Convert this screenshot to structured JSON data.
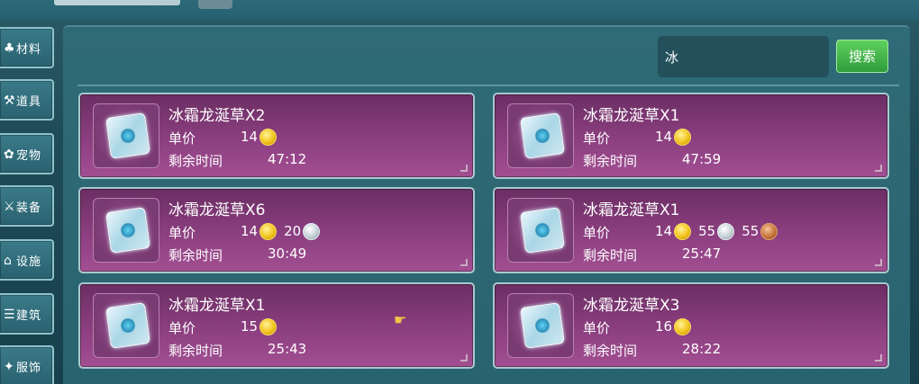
{
  "sidebar": {
    "items": [
      {
        "label": "材料",
        "icon": "leaf-icon"
      },
      {
        "label": "道具",
        "icon": "pickaxe-icon"
      },
      {
        "label": "宠物",
        "icon": "pet-icon"
      },
      {
        "label": "装备",
        "icon": "sword-icon"
      },
      {
        "label": "设施",
        "icon": "facility-icon"
      },
      {
        "label": "建筑",
        "icon": "building-icon"
      },
      {
        "label": "服饰",
        "icon": "clothes-icon"
      }
    ]
  },
  "search": {
    "value": "冰",
    "button_label": "搜索"
  },
  "labels": {
    "price": "单价",
    "time": "剩余时间"
  },
  "listings": [
    {
      "name": "冰霜龙涎草X2",
      "time": "47:12",
      "prices": [
        {
          "amount": "14",
          "coin": "gold"
        }
      ]
    },
    {
      "name": "冰霜龙涎草X1",
      "time": "47:59",
      "prices": [
        {
          "amount": "14",
          "coin": "gold"
        }
      ]
    },
    {
      "name": "冰霜龙涎草X6",
      "time": "30:49",
      "prices": [
        {
          "amount": "14",
          "coin": "gold"
        },
        {
          "amount": "20",
          "coin": "silver"
        }
      ]
    },
    {
      "name": "冰霜龙涎草X1",
      "time": "25:47",
      "prices": [
        {
          "amount": "14",
          "coin": "gold"
        },
        {
          "amount": "55",
          "coin": "silver"
        },
        {
          "amount": "55",
          "coin": "bronze"
        }
      ]
    },
    {
      "name": "冰霜龙涎草X1",
      "time": "25:43",
      "prices": [
        {
          "amount": "15",
          "coin": "gold"
        }
      ]
    },
    {
      "name": "冰霜龙涎草X3",
      "time": "28:22",
      "prices": [
        {
          "amount": "16",
          "coin": "gold"
        }
      ]
    }
  ]
}
